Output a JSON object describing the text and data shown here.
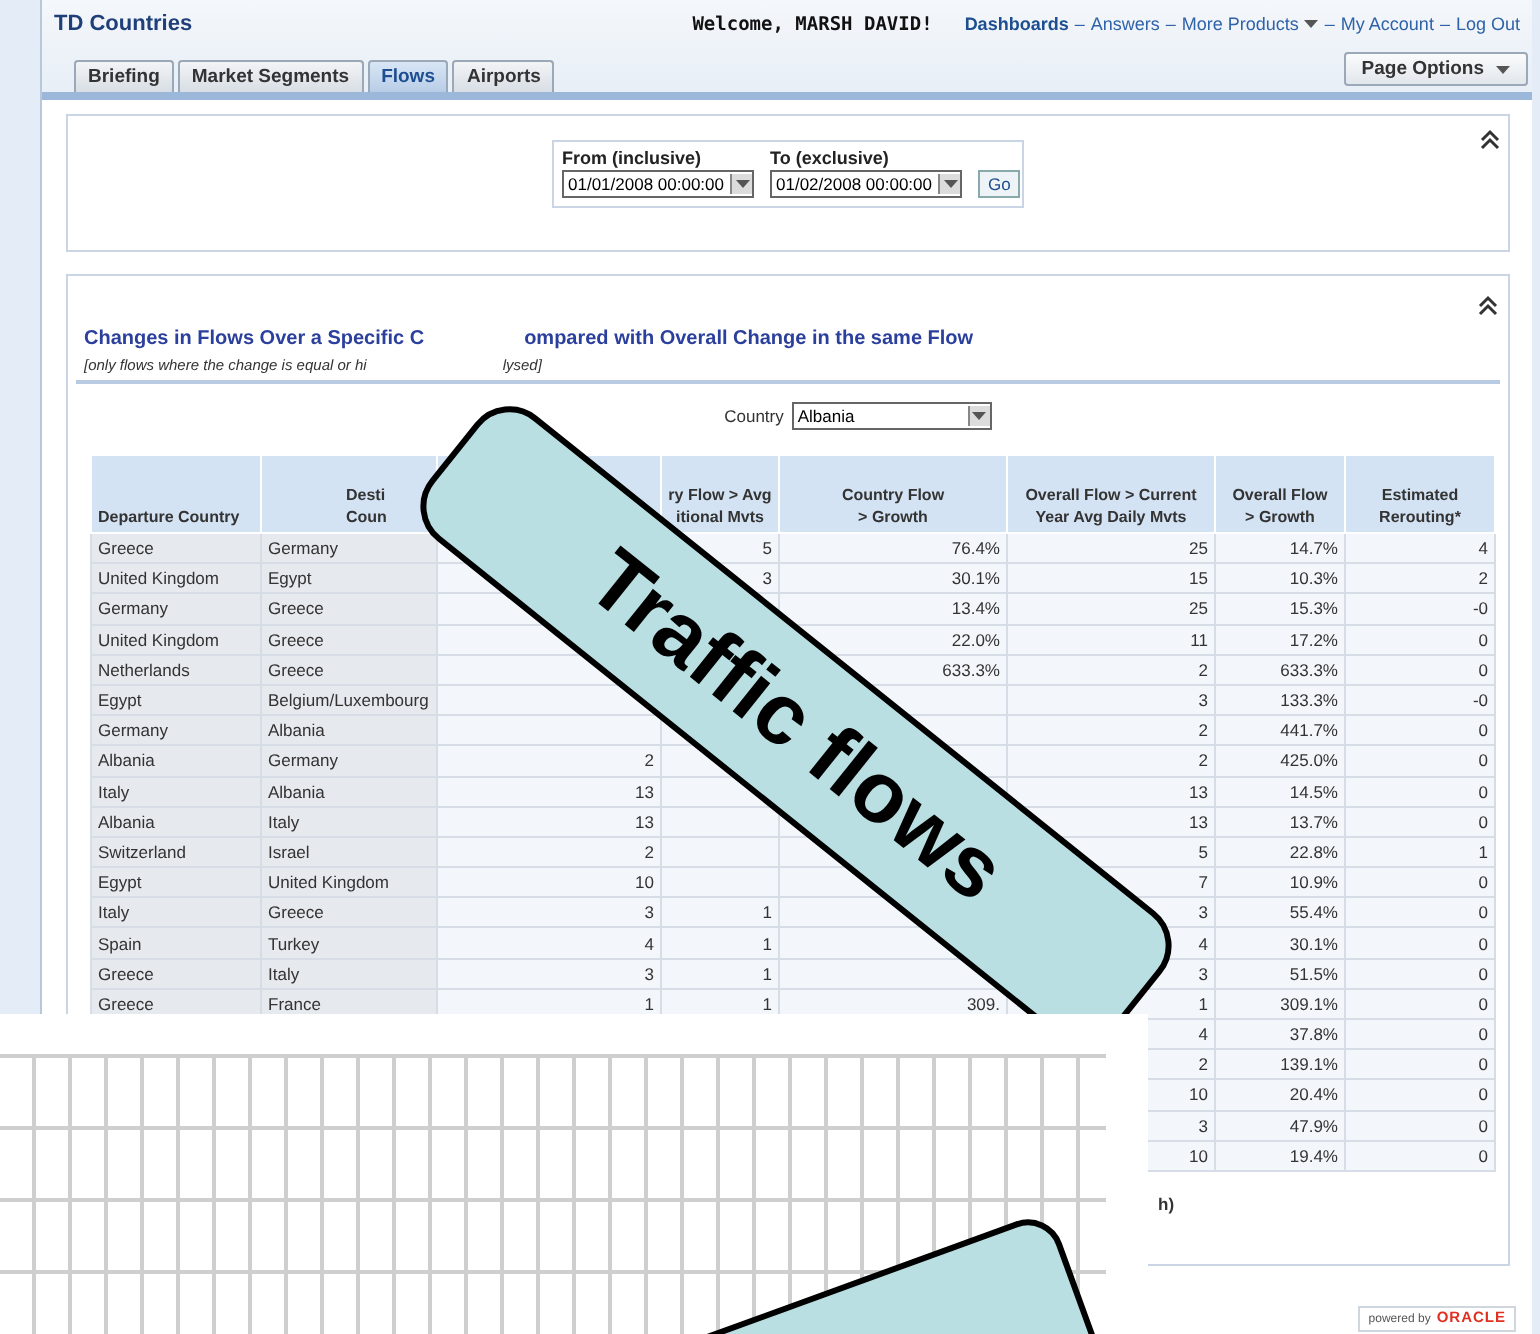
{
  "header": {
    "app_title": "TD Countries",
    "welcome": "Welcome, MARSH DAVID!",
    "links": [
      {
        "label": "Dashboards",
        "kind": "current"
      },
      {
        "label": "Answers",
        "kind": "link",
        "separator": "–"
      },
      {
        "label": "More Products",
        "kind": "menu",
        "separator": "–"
      },
      {
        "label": "My Account",
        "kind": "link",
        "separator": "–"
      },
      {
        "label": "Log Out",
        "kind": "link",
        "separator": "–"
      }
    ]
  },
  "tabs": [
    {
      "label": "Briefing",
      "selected": false
    },
    {
      "label": "Market Segments",
      "selected": false
    },
    {
      "label": "Flows",
      "selected": true
    },
    {
      "label": "Airports",
      "selected": false
    }
  ],
  "page_options": {
    "label": "Page Options"
  },
  "date_prompts": {
    "from": {
      "label": "From (inclusive)",
      "value": "01/01/2008 00:00:00"
    },
    "to": {
      "label": "To (exclusive)",
      "value": "01/02/2008 00:00:00"
    },
    "go_button": "Go"
  },
  "report": {
    "title_parts": [
      "Changes in Flows Over a Specific C",
      "ompared with Overall Change in the same Flow"
    ],
    "subtitle_parts": [
      "[only flows where the change is equal or hi",
      "lysed]"
    ],
    "country_prompt": {
      "label": "Country",
      "value": "Albania"
    },
    "table": {
      "columns": [
        {
          "lines": [
            "Departure Country"
          ]
        },
        {
          "lines": [
            "Desti",
            "Coun"
          ]
        },
        null,
        {
          "lines": [
            "ry Flow > Avg",
            "itional Mvts"
          ]
        },
        {
          "lines": [
            "Country Flow",
            "> Growth"
          ]
        },
        {
          "lines": [
            "Overall Flow > Current",
            "Year Avg Daily Mvts"
          ]
        },
        {
          "lines": [
            "Overall Flow",
            "> Growth"
          ]
        },
        {
          "lines": [
            "Estimated",
            "Rerouting*"
          ]
        }
      ],
      "rows": [
        {
          "cells": [
            "Greece",
            "Germany",
            null,
            "5",
            "76.4%",
            "25",
            "14.7%",
            "4"
          ]
        },
        {
          "cells": [
            "United Kingdom",
            "Egypt",
            null,
            "3",
            "30.1%",
            "15",
            "10.3%",
            "2"
          ]
        },
        {
          "cells": [
            "Germany",
            "Greece",
            null,
            null,
            "13.4%",
            "25",
            "15.3%",
            "-0"
          ]
        },
        {
          "cells": [
            "United Kingdom",
            "Greece",
            null,
            null,
            "22.0%",
            "11",
            "17.2%",
            "0"
          ]
        },
        {
          "cells": [
            "Netherlands",
            "Greece",
            null,
            null,
            "633.3%",
            "2",
            "633.3%",
            "0"
          ]
        },
        {
          "cells": [
            "Egypt",
            "Belgium/Luxembourg",
            null,
            null,
            null,
            "3",
            "133.3%",
            "-0"
          ]
        },
        {
          "cells": [
            "Germany",
            "Albania",
            null,
            null,
            null,
            "2",
            "441.7%",
            "0"
          ]
        },
        {
          "cells": [
            "Albania",
            "Germany",
            "2",
            null,
            null,
            "2",
            "425.0%",
            "0"
          ]
        },
        {
          "cells": [
            "Italy",
            "Albania",
            "13",
            null,
            null,
            "13",
            "14.5%",
            "0"
          ]
        },
        {
          "cells": [
            "Albania",
            "Italy",
            "13",
            null,
            null,
            "13",
            "13.7%",
            "0"
          ]
        },
        {
          "cells": [
            "Switzerland",
            "Israel",
            "2",
            null,
            null,
            "5",
            "22.8%",
            "1"
          ]
        },
        {
          "cells": [
            "Egypt",
            "United Kingdom",
            "10",
            null,
            null,
            "7",
            "10.9%",
            "0"
          ]
        },
        {
          "cells": [
            "Italy",
            "Greece",
            "3",
            "1",
            null,
            "3",
            "55.4%",
            "0"
          ]
        },
        {
          "cells": [
            "Spain",
            "Turkey",
            "4",
            "1",
            null,
            "4",
            "30.1%",
            "0"
          ]
        },
        {
          "cells": [
            "Greece",
            "Italy",
            "3",
            "1",
            null,
            "3",
            "51.5%",
            "0"
          ]
        },
        {
          "cells": [
            "Greece",
            "France",
            "1",
            "1",
            "309.",
            "1",
            "309.1%",
            "0"
          ]
        },
        {
          "cells": [
            null,
            null,
            null,
            null,
            null,
            "4",
            "37.8%",
            "0"
          ]
        },
        {
          "cells": [
            null,
            null,
            null,
            null,
            null,
            "2",
            "139.1%",
            "0"
          ]
        },
        {
          "cells": [
            null,
            null,
            null,
            null,
            null,
            "10",
            "20.4%",
            "0"
          ]
        },
        {
          "cells": [
            null,
            null,
            null,
            null,
            null,
            "3",
            "47.9%",
            "0"
          ]
        },
        {
          "cells": [
            null,
            null,
            null,
            null,
            null,
            "10",
            "19.4%",
            "0"
          ]
        }
      ]
    },
    "footnote": "h)"
  },
  "footer": {
    "powered_by": "powered by",
    "brand": "ORACLE"
  },
  "callouts": [
    {
      "kind": "text",
      "text": "Traffic flows"
    },
    {
      "kind": "blank"
    }
  ]
}
